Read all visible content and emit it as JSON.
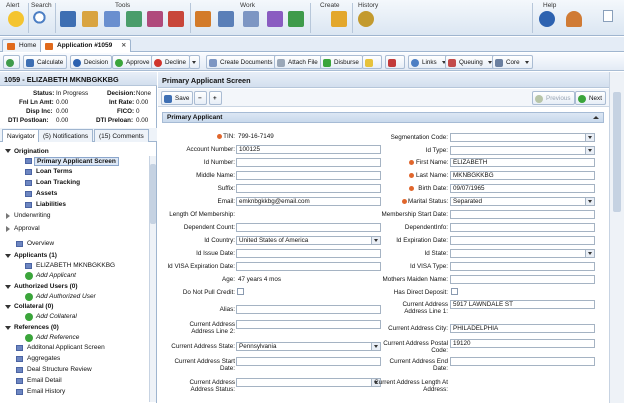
{
  "ribbon": {
    "groups": [
      "Alert",
      "Search",
      "Tools",
      "Work",
      "Create",
      "History",
      "Help"
    ]
  },
  "tabs": {
    "home": "Home",
    "app": "Application #1059",
    "close": "✕"
  },
  "toolbar": {
    "calculate": "Calculate",
    "decision": "Decision",
    "approve": "Approve",
    "decline": "Decline",
    "create_docs": "Create Documents",
    "attach": "Attach File",
    "disburse": "Disburse",
    "links": "Links",
    "queuing": "Queuing",
    "core": "Core"
  },
  "summary": {
    "title": "1059 - ELIZABETH MKNBGKKBG",
    "status_l": "Status:",
    "status_v": "In Progress",
    "decision_l": "Decision:",
    "decision_v": "None",
    "fnl_l": "Fnl Ln Amt:",
    "fnl_v": "0.00",
    "rate_l": "Int Rate:",
    "rate_v": "0.00",
    "disb_l": "Disp Inc:",
    "disb_v": "0.00",
    "fico_l": "FICO:",
    "fico_v": "0",
    "dti_l": "DTI Postloan:",
    "dti_v": "0.00",
    "dtip_l": "DTI Preloan:",
    "dtip_v": "0.00"
  },
  "navtabs": {
    "navigator": "Navigator",
    "notifications": "(5) Notifications",
    "comments": "(15) Comments"
  },
  "nav": {
    "origination": "Origination",
    "items": [
      "Primary Applicant Screen",
      "Loan Terms",
      "Loan Tracking",
      "Assets",
      "Liabilities"
    ],
    "underwriting": "Underwriting",
    "approval": "Approval",
    "overview": "Overview",
    "applicants": "Applicants (1)",
    "applicant_name": "ELIZABETH MKNBGKKBG",
    "add_applicant": "Add Applicant",
    "auth_users": "Authorized Users (0)",
    "add_auth": "Add Authorized User",
    "collateral": "Collateral (0)",
    "add_collateral": "Add Collateral",
    "references": "References (0)",
    "add_reference": "Add Reference",
    "others": [
      "Additonal Applicant Screen",
      "Aggregates",
      "Deal Structure Review",
      "Email Detail",
      "Email History"
    ]
  },
  "main": {
    "title": "Primary Applicant Screen",
    "save": "Save",
    "previous": "Previous",
    "next": "Next",
    "section": "Primary Applicant"
  },
  "form": {
    "tin_l": "TIN:",
    "tin_v": "799-16-7149",
    "acct_l": "Account Number:",
    "acct_v": "100125",
    "idnum_l": "Id Number:",
    "mid_l": "Middle Name:",
    "suffix_l": "Suffix:",
    "email_l": "Email:",
    "email_v": "emknbgkkbg@email.com",
    "lom_l": "Length Of Membership:",
    "dep_l": "Dependent Count:",
    "idcountry_l": "Id Country:",
    "idcountry_v": "United States of America",
    "idissue_l": "Id Issue Date:",
    "visaexp_l": "Id VISA Expiration Date:",
    "age_l": "Age:",
    "age_v": "47 years 4 mos",
    "dnp_l": "Do Not Pull Credit:",
    "alias_l": "Alias:",
    "addr2_l": "Current Address Address Line 2:",
    "state_l": "Current Address State:",
    "state_v": "Pennsylvania",
    "start_l": "Current Address Start Date:",
    "status_l": "Current Address Address Status:",
    "seg_l": "Segmentation Code:",
    "idtype_l": "Id Type:",
    "first_l": "First Name:",
    "first_v": "ELIZABETH",
    "last_l": "Last Name:",
    "last_v": "MKNBGKKBG",
    "birth_l": "Birth Date:",
    "birth_v": "09/07/1965",
    "marital_l": "Marital Status:",
    "marital_v": "Separated",
    "msd_l": "Membership Start Date:",
    "depinfo_l": "DependentInfo:",
    "idexp_l": "Id Expiration Date:",
    "idstate_l": "Id State:",
    "visatype_l": "Id VISA Type:",
    "maiden_l": "Mothers Maiden Name:",
    "direct_l": "Has Direct Deposit:",
    "addr1_l": "Current Address Address Line 1:",
    "addr1_v": "5917 LAWNDALE ST",
    "city_l": "Current Address City:",
    "city_v": "PHILADELPHIA",
    "zip_l": "Current Address Postal Code:",
    "zip_v": "19120",
    "end_l": "Current Address End Date:",
    "len_l": "Current Address Length At Address:"
  }
}
